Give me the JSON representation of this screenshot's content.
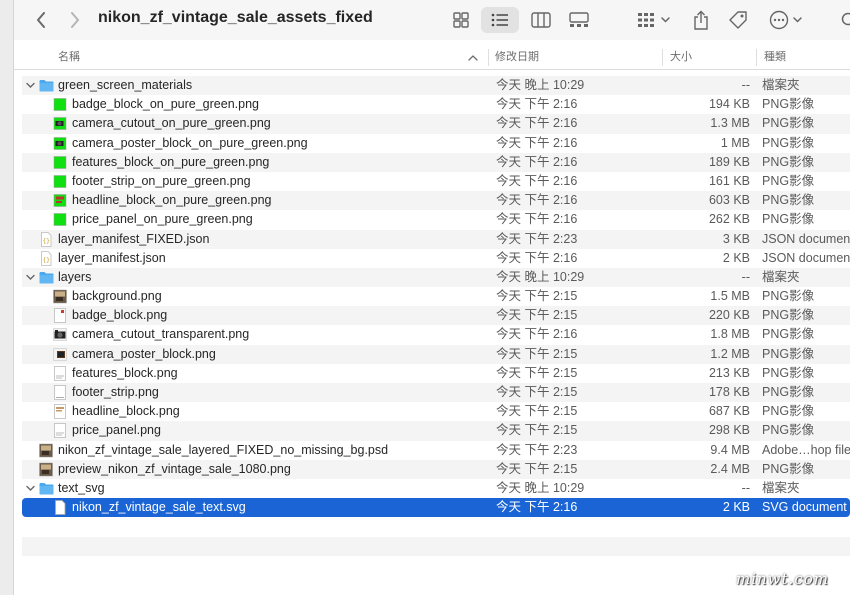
{
  "window": {
    "title": "nikon_zf_vintage_sale_assets_fixed"
  },
  "toolbar": {
    "back_icon": "chevron-left-icon",
    "forward_icon": "chevron-right-icon",
    "views": [
      "icon-view-icon",
      "list-view-icon",
      "column-view-icon",
      "gallery-view-icon"
    ],
    "active_view": "list-view-icon"
  },
  "columns": {
    "name": "名稱",
    "date": "修改日期",
    "size": "大小",
    "kind": "種類"
  },
  "colors": {
    "selection": "#1a64d6",
    "folder": "#4aa8ec",
    "green": "#10e010"
  },
  "rows": [
    {
      "name": "green_screen_materials",
      "date": "今天 晚上 10:29",
      "size": "--",
      "kind": "檔案夾",
      "type": "folder",
      "level": 0
    },
    {
      "name": "badge_block_on_pure_green.png",
      "date": "今天 下午 2:16",
      "size": "194 KB",
      "kind": "PNG影像",
      "type": "green",
      "level": 1
    },
    {
      "name": "camera_cutout_on_pure_green.png",
      "date": "今天 下午 2:16",
      "size": "1.3 MB",
      "kind": "PNG影像",
      "type": "green-camera",
      "level": 1
    },
    {
      "name": "camera_poster_block_on_pure_green.png",
      "date": "今天 下午 2:16",
      "size": "1 MB",
      "kind": "PNG影像",
      "type": "green-camera",
      "level": 1
    },
    {
      "name": "features_block_on_pure_green.png",
      "date": "今天 下午 2:16",
      "size": "189 KB",
      "kind": "PNG影像",
      "type": "green",
      "level": 1
    },
    {
      "name": "footer_strip_on_pure_green.png",
      "date": "今天 下午 2:16",
      "size": "161 KB",
      "kind": "PNG影像",
      "type": "green",
      "level": 1
    },
    {
      "name": "headline_block_on_pure_green.png",
      "date": "今天 下午 2:16",
      "size": "603 KB",
      "kind": "PNG影像",
      "type": "green-red",
      "level": 1
    },
    {
      "name": "price_panel_on_pure_green.png",
      "date": "今天 下午 2:16",
      "size": "262 KB",
      "kind": "PNG影像",
      "type": "green",
      "level": 1
    },
    {
      "name": "layer_manifest_FIXED.json",
      "date": "今天 下午 2:23",
      "size": "3 KB",
      "kind": "JSON document",
      "type": "json",
      "level": 0
    },
    {
      "name": "layer_manifest.json",
      "date": "今天 下午 2:16",
      "size": "2 KB",
      "kind": "JSON document",
      "type": "json",
      "level": 0
    },
    {
      "name": "layers",
      "date": "今天 晚上 10:29",
      "size": "--",
      "kind": "檔案夾",
      "type": "folder",
      "level": 0
    },
    {
      "name": "background.png",
      "date": "今天 下午 2:15",
      "size": "1.5 MB",
      "kind": "PNG影像",
      "type": "photo",
      "level": 1
    },
    {
      "name": "badge_block.png",
      "date": "今天 下午 2:15",
      "size": "220 KB",
      "kind": "PNG影像",
      "type": "doc-red",
      "level": 1
    },
    {
      "name": "camera_cutout_transparent.png",
      "date": "今天 下午 2:16",
      "size": "1.8 MB",
      "kind": "PNG影像",
      "type": "camera",
      "level": 1
    },
    {
      "name": "camera_poster_block.png",
      "date": "今天 下午 2:15",
      "size": "1.2 MB",
      "kind": "PNG影像",
      "type": "camera-small",
      "level": 1
    },
    {
      "name": "features_block.png",
      "date": "今天 下午 2:15",
      "size": "213 KB",
      "kind": "PNG影像",
      "type": "doc-lines",
      "level": 1
    },
    {
      "name": "footer_strip.png",
      "date": "今天 下午 2:15",
      "size": "178 KB",
      "kind": "PNG影像",
      "type": "doc-blank",
      "level": 1
    },
    {
      "name": "headline_block.png",
      "date": "今天 下午 2:15",
      "size": "687 KB",
      "kind": "PNG影像",
      "type": "doc-text",
      "level": 1
    },
    {
      "name": "price_panel.png",
      "date": "今天 下午 2:15",
      "size": "298 KB",
      "kind": "PNG影像",
      "type": "doc-lines",
      "level": 1
    },
    {
      "name": "nikon_zf_vintage_sale_layered_FIXED_no_missing_bg.psd",
      "date": "今天 下午 2:23",
      "size": "9.4 MB",
      "kind": "Adobe…hop file",
      "type": "photo",
      "level": 0
    },
    {
      "name": "preview_nikon_zf_vintage_sale_1080.png",
      "date": "今天 下午 2:15",
      "size": "2.4 MB",
      "kind": "PNG影像",
      "type": "photo",
      "level": 0
    },
    {
      "name": "text_svg",
      "date": "今天 晚上 10:29",
      "size": "--",
      "kind": "檔案夾",
      "type": "folder",
      "level": 0
    },
    {
      "name": "nikon_zf_vintage_sale_text.svg",
      "date": "今天 下午 2:16",
      "size": "2 KB",
      "kind": "SVG document",
      "type": "svg",
      "level": 1,
      "selected": true
    }
  ],
  "watermark": "minwt.com"
}
